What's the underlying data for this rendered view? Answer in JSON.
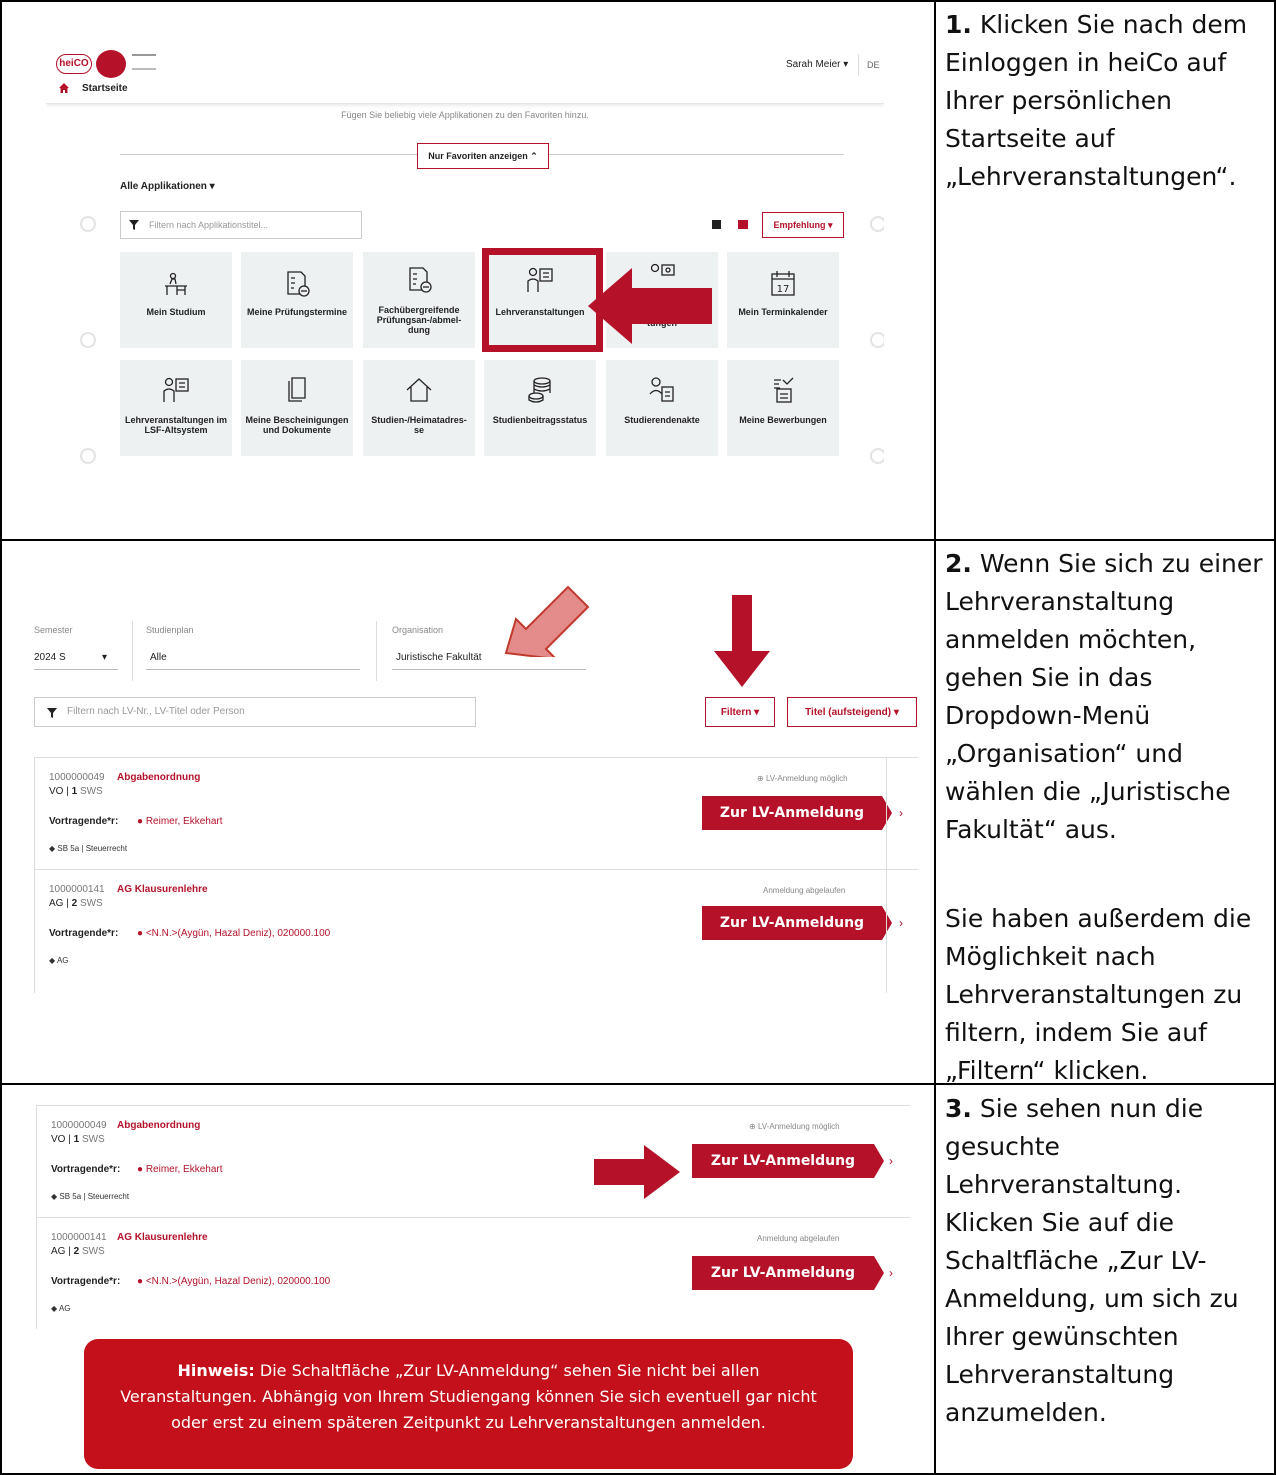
{
  "step1": {
    "number": "1.",
    "text": "Klicken Sie nach dem Einloggen in heiCo auf Ihrer persönlichen Startseite auf „Lehrveranstaltungen“.",
    "screenshot": {
      "logo_text": "heiCO",
      "user_name": "Sarah Meier",
      "language": "DE",
      "breadcrumb": "Startseite",
      "hint": "Fügen Sie beliebig viele Applikationen zu den Favoriten hinzu.",
      "favorites_button": "Nur Favoriten anzeigen",
      "all_apps_label": "Alle Applikationen",
      "filter_placeholder": "Filtern nach Applikationstitel...",
      "recommend_button": "Empfehlung",
      "tiles": [
        {
          "label": "Mein Studium",
          "icon": "desk-icon"
        },
        {
          "label": "Meine Prüfungstermine",
          "icon": "exam-document-icon"
        },
        {
          "label": "Fachübergreifende Prüfungsan-/abmel-dung",
          "icon": "exam-document-icon"
        },
        {
          "label": "Lehrveranstaltungen",
          "icon": "lecturer-board-icon"
        },
        {
          "label": "tungen",
          "icon": "lecturer-screen-icon"
        },
        {
          "label": "Mein Terminkalender",
          "icon": "calendar-icon"
        },
        {
          "label": "Lehrveranstaltungen im LSF-Altsystem",
          "icon": "lecturer-board-icon"
        },
        {
          "label": "Meine Bescheinigungen und Dokumente",
          "icon": "documents-icon"
        },
        {
          "label": "Studien-/Heimatadres-se",
          "icon": "house-icon"
        },
        {
          "label": "Studienbeitragsstatus",
          "icon": "coins-icon"
        },
        {
          "label": "Studierendenakte",
          "icon": "student-file-icon"
        },
        {
          "label": "Meine Bewerbungen",
          "icon": "application-icon"
        }
      ],
      "calendar_day": "17"
    }
  },
  "step2": {
    "number": "2.",
    "text1": "Wenn Sie sich zu einer Lehrveranstaltung anmelden möchten, gehen Sie in das Dropdown-Menü „Organisation“ und wählen die „Juristische Fakultät“ aus.",
    "text2": "Sie haben außerdem die Möglichkeit nach Lehrveranstaltungen zu filtern, indem Sie auf „Filtern“ klicken.",
    "screenshot": {
      "semester_label": "Semester",
      "semester_value": "2024 S",
      "studienplan_label": "Studienplan",
      "studienplan_value": "Alle",
      "organisation_label": "Organisation",
      "organisation_value": "Juristische Fakultät",
      "filter_placeholder": "Filtern nach LV-Nr., LV-Titel oder Person",
      "filter_button": "Filtern",
      "sort_button": "Titel (aufsteigend)"
    }
  },
  "courses": [
    {
      "number": "1000000049",
      "title": "Abgabenordnung",
      "type": "VO",
      "sws": "1",
      "sws_unit": "SWS",
      "lecturer_label": "Vortragende*r:",
      "lecturer": "Reimer, Ekkehart",
      "tag": "SB 5a | Steuerrecht",
      "status": "LV-Anmeldung möglich",
      "button": "Zur LV-Anmeldung"
    },
    {
      "number": "1000000141",
      "title": "AG Klausurenlehre",
      "type": "AG",
      "sws": "2",
      "sws_unit": "SWS",
      "lecturer_label": "Vortragende*r:",
      "lecturer": "<N.N.>(Aygün, Hazal Deniz), 020000.100",
      "tag": "AG",
      "status": "Anmeldung abgelaufen",
      "button": "Zur LV-Anmeldung"
    }
  ],
  "step3": {
    "number": "3.",
    "text": "Sie sehen nun die gesuchte Lehrveranstaltung. Klicken Sie auf die Schaltfläche „Zur LV-Anmeldung, um sich zu Ihrer gewünschten Lehrveranstaltung anzumelden.",
    "note_label": "Hinweis:",
    "note_text": "Die Schaltfläche „Zur LV-Anmeldung“ sehen Sie nicht bei allen Veranstaltungen. Abhängig von Ihrem Studiengang können Sie sich eventuell gar nicht oder erst zu einem späteren Zeitpunkt zu Lehrveranstaltungen anmelden."
  },
  "colors": {
    "accent": "#b5122a",
    "note_bg": "#c4101a",
    "tile_bg": "#eef1f2"
  }
}
